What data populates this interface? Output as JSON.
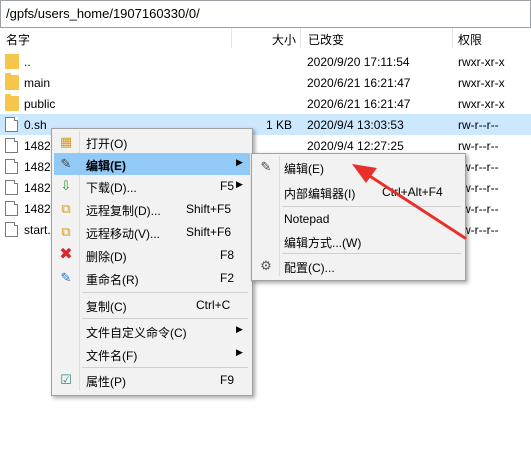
{
  "path": "/gpfs/users_home/1907160330/0/",
  "columns": {
    "name": "名字",
    "size": "大小",
    "modified": "已改变",
    "perms": "权限"
  },
  "files": [
    {
      "name": "..",
      "size": "",
      "modified": "2020/9/20 17:11:54",
      "perms": "rwxr-xr-x",
      "icon": "parent-dir-icon"
    },
    {
      "name": "main",
      "size": "",
      "modified": "2020/6/21 16:21:47",
      "perms": "rwxr-xr-x",
      "icon": "folder-icon"
    },
    {
      "name": "public",
      "size": "",
      "modified": "2020/6/21 16:21:47",
      "perms": "rwxr-xr-x",
      "icon": "folder-icon"
    },
    {
      "name": "0.sh",
      "size": "1 KB",
      "modified": "2020/9/4 13:03:53",
      "perms": "rw-r--r--",
      "icon": "file-icon"
    },
    {
      "name": "1482",
      "size": "",
      "modified": "2020/9/4 12:27:25",
      "perms": "rw-r--r--",
      "icon": "file-icon"
    },
    {
      "name": "1482",
      "size": "",
      "modified": "",
      "perms": "rw-r--r--",
      "icon": "file-icon"
    },
    {
      "name": "1482",
      "size": "",
      "modified": "",
      "perms": "rw-r--r--",
      "icon": "file-icon"
    },
    {
      "name": "1482",
      "size": "",
      "modified": "",
      "perms": "rw-r--r--",
      "icon": "file-icon"
    },
    {
      "name": "start.",
      "size": "",
      "modified": "",
      "perms": "rw-r--r--",
      "icon": "file-icon"
    }
  ],
  "context_menu": [
    {
      "label": "打开(O)",
      "shortcut": ""
    },
    {
      "label": "编辑(E)",
      "shortcut": ""
    },
    {
      "label": "下载(D)...",
      "shortcut": "F5"
    },
    {
      "label": "远程复制(D)...",
      "shortcut": "Shift+F5"
    },
    {
      "label": "远程移动(V)...",
      "shortcut": "Shift+F6"
    },
    {
      "label": "删除(D)",
      "shortcut": "F8"
    },
    {
      "label": "重命名(R)",
      "shortcut": "F2"
    },
    {
      "label": "复制(C)",
      "shortcut": "Ctrl+C"
    },
    {
      "label": "文件自定义命令(C)",
      "shortcut": ""
    },
    {
      "label": "文件名(F)",
      "shortcut": ""
    },
    {
      "label": "属性(P)",
      "shortcut": "F9"
    }
  ],
  "submenu": [
    {
      "label": "编辑(E)",
      "shortcut": ""
    },
    {
      "label": "内部编辑器(I)",
      "shortcut": "Ctrl+Alt+F4"
    },
    {
      "label": "Notepad",
      "shortcut": ""
    },
    {
      "label": "编辑方式...(W)",
      "shortcut": ""
    },
    {
      "label": "配置(C)...",
      "shortcut": ""
    }
  ],
  "colors": {
    "selection": "#cce8ff",
    "menu_highlight": "#91c9f7",
    "annotation_arrow": "#e8302a"
  }
}
